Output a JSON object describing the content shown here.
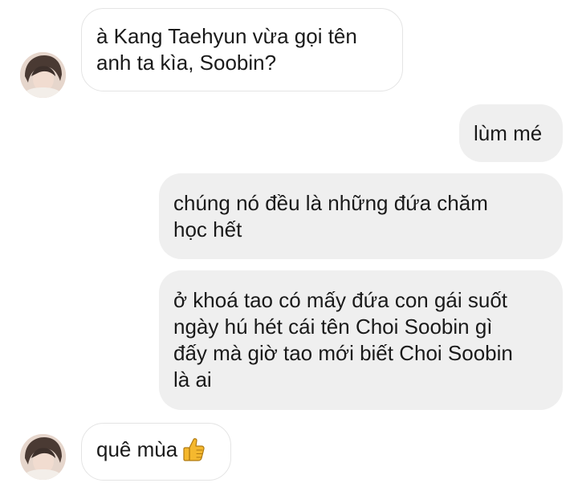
{
  "thread": {
    "messages": [
      {
        "id": "m1",
        "direction": "incoming",
        "lines": [
          "à Kang Taehyun vừa gọi tên",
          "anh ta kìa, Soobin?"
        ]
      },
      {
        "id": "m2",
        "direction": "outgoing",
        "lines": [
          "lùm mé"
        ]
      },
      {
        "id": "m3",
        "direction": "outgoing",
        "lines": [
          "chúng nó đều là những đứa chăm",
          "học hết"
        ]
      },
      {
        "id": "m4",
        "direction": "outgoing",
        "lines": [
          "ở khoá tao có mấy đứa con gái suốt",
          "ngày hú hét cái tên Choi Soobin gì",
          "đấy mà giờ tao mới biết Choi Soobin",
          "là ai"
        ]
      },
      {
        "id": "m5",
        "direction": "incoming",
        "text": "quê mùa",
        "emoji": "thumbs-up-icon"
      }
    ]
  },
  "colors": {
    "incoming_bubble_bg": "#ffffff",
    "incoming_bubble_border": "#e4e4e4",
    "outgoing_bubble_bg": "#efefef",
    "text": "#1a1a1a",
    "thumb_emoji": "#f5b82e"
  }
}
